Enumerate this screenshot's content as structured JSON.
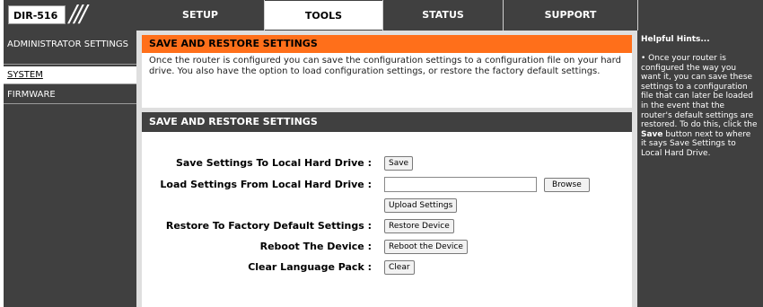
{
  "header": {
    "model": "DIR-516",
    "tabs": [
      {
        "label": "SETUP",
        "active": false
      },
      {
        "label": "TOOLS",
        "active": true
      },
      {
        "label": "STATUS",
        "active": false
      },
      {
        "label": "SUPPORT",
        "active": false
      }
    ]
  },
  "sidebar": {
    "items": [
      {
        "label": "ADMINISTRATOR SETTINGS",
        "active": false
      },
      {
        "label": "SYSTEM",
        "active": true
      },
      {
        "label": "FIRMWARE",
        "active": false
      }
    ]
  },
  "intro": {
    "title": "SAVE AND RESTORE SETTINGS",
    "text": "Once the router is configured you can save the configuration settings to a configuration file on your hard drive. You also have the option to load configuration settings, or restore the factory default settings."
  },
  "settings": {
    "title": "SAVE AND RESTORE SETTINGS",
    "save_label": "Save Settings To Local Hard Drive :",
    "save_button": "Save",
    "load_label": "Load Settings From Local Hard Drive :",
    "file_value": "",
    "browse_button": "Browse",
    "upload_button": "Upload Settings",
    "restore_label": "Restore To Factory Default Settings :",
    "restore_button": "Restore Device",
    "reboot_label": "Reboot The Device :",
    "reboot_button": "Reboot the Device",
    "clear_label": "Clear Language Pack :",
    "clear_button": "Clear"
  },
  "help": {
    "title": "Helpful Hints...",
    "text_before": "• Once your router is configured the way you want it, you can save these settings to a configuration file that can later be loaded in the event that the router's default settings are restored. To do this, click the ",
    "text_bold": "Save",
    "text_after": " button next to where it says Save Settings to Local Hard Drive."
  },
  "colors": {
    "dark": "#404040",
    "accent_orange": "#ff6f1a",
    "content_bg": "#dfdfdf"
  }
}
